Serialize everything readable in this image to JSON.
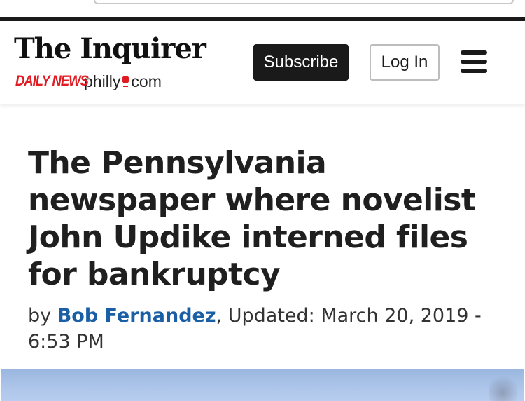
{
  "header": {
    "masthead": "The Inquirer",
    "daily_news": "DAILY NEWS",
    "philly_prefix": "philly",
    "philly_suffix": "com",
    "subscribe_label": "Subscribe",
    "login_label": "Log In",
    "menu_icon": "hamburger-menu-icon"
  },
  "article": {
    "headline": "The Pennsylvania newspaper where novelist John Updike interned files for bankruptcy",
    "byline_prefix": "by ",
    "author": "Bob Fernandez",
    "updated": ", Updated: March 20, 2019 - 6:53 PM"
  },
  "colors": {
    "brand_red": "#e01b22",
    "byline_blue": "#1a5fa6",
    "dark": "#1a1a1a"
  }
}
